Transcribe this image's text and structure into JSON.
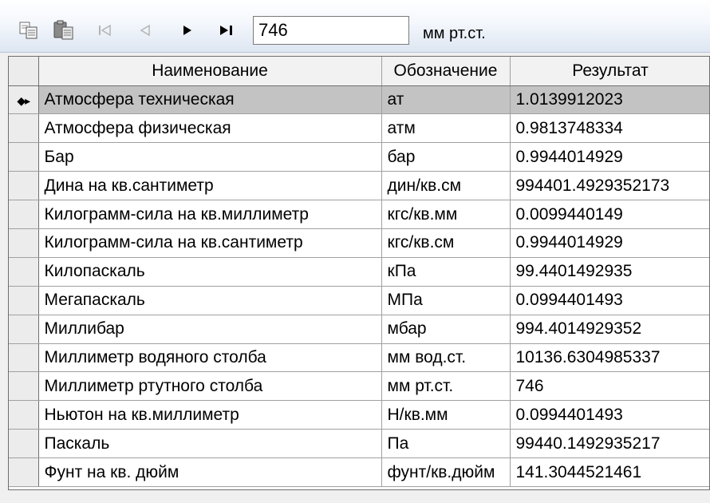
{
  "toolbar": {
    "buttons": [
      {
        "name": "copy-icon",
        "enabled": true
      },
      {
        "name": "paste-icon",
        "enabled": true
      },
      {
        "name": "first-record-icon",
        "enabled": false
      },
      {
        "name": "prior-record-icon",
        "enabled": false
      },
      {
        "name": "next-record-icon",
        "enabled": true
      },
      {
        "name": "last-record-icon",
        "enabled": true
      }
    ],
    "input_value": "746",
    "unit_label": "мм рт.ст."
  },
  "grid": {
    "columns": [
      "Наименование",
      "Обозначение",
      "Результат"
    ],
    "selected_row": 0,
    "rows": [
      {
        "name": "Атмосфера техническая",
        "symbol": "ат",
        "result": "1.0139912023"
      },
      {
        "name": "Атмосфера физическая",
        "symbol": "атм",
        "result": "0.9813748334"
      },
      {
        "name": "Бар",
        "symbol": "бар",
        "result": "0.9944014929"
      },
      {
        "name": "Дина на кв.сантиметр",
        "symbol": "дин/кв.см",
        "result": "994401.4929352173"
      },
      {
        "name": "Килограмм-сила на кв.миллиметр",
        "symbol": "кгс/кв.мм",
        "result": "0.0099440149"
      },
      {
        "name": "Килограмм-сила на кв.сантиметр",
        "symbol": "кгс/кв.см",
        "result": "0.9944014929"
      },
      {
        "name": "Килопаскаль",
        "symbol": "кПа",
        "result": "99.4401492935"
      },
      {
        "name": "Мегапаскаль",
        "symbol": "МПа",
        "result": "0.0994401493"
      },
      {
        "name": "Миллибар",
        "symbol": "мбар",
        "result": "994.4014929352"
      },
      {
        "name": "Миллиметр водяного столба",
        "symbol": "мм вод.ст.",
        "result": "10136.6304985337"
      },
      {
        "name": "Миллиметр ртутного столба",
        "symbol": "мм рт.ст.",
        "result": "746"
      },
      {
        "name": "Ньютон на кв.миллиметр",
        "symbol": "Н/кв.мм",
        "result": "0.0994401493"
      },
      {
        "name": "Паскаль",
        "symbol": "Па",
        "result": "99440.1492935217"
      },
      {
        "name": "Фунт на кв. дюйм",
        "symbol": "фунт/кв.дюйм",
        "result": "141.3044521461"
      }
    ]
  }
}
